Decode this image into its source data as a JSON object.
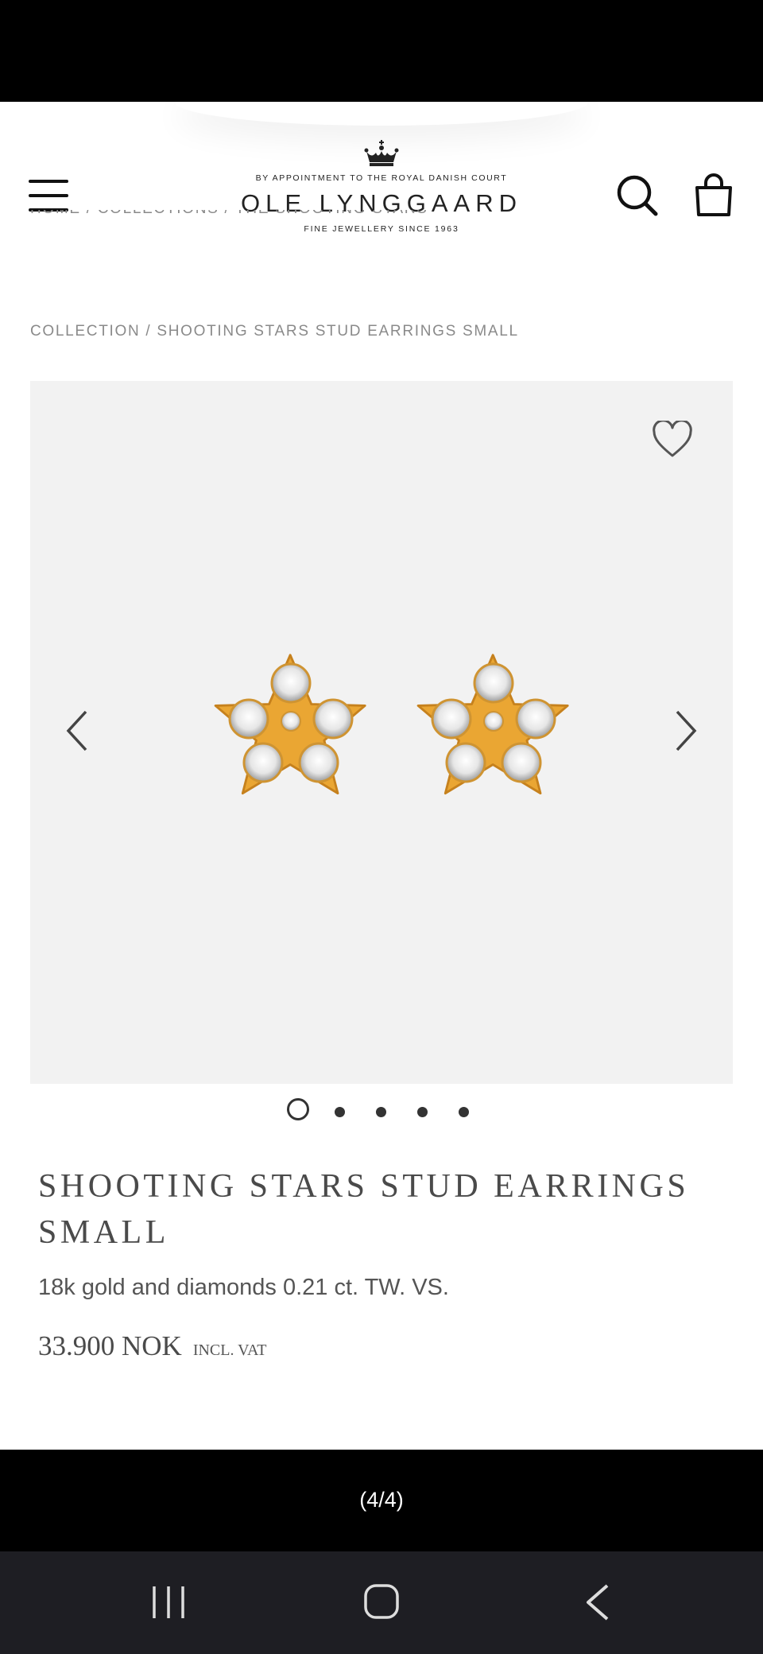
{
  "header": {
    "logo_top": "BY APPOINTMENT TO THE ROYAL DANISH COURT",
    "logo_name": "OLE LYNGGAARD",
    "logo_bottom": "FINE JEWELLERY SINCE 1963"
  },
  "breadcrumb": {
    "items": [
      "HOME",
      "COLLECTIONS",
      "THE SHOOTING STARS COLLECTION",
      "SHOOTING STARS STUD EARRINGS SMALL"
    ],
    "line1": "HOME / COLLECTIONS / THE SHOOTING STARS",
    "line2_link": "COLLECTION",
    "separator": " / ",
    "line2_current": "SHOOTING STARS STUD EARRINGS SMALL"
  },
  "gallery": {
    "image_count": 5,
    "active_index": 0
  },
  "product": {
    "title": "SHOOTING STARS STUD EARRINGS SMALL",
    "description": "18k gold and diamonds 0.21 ct. TW. VS.",
    "price": "33.900 NOK",
    "vat_label": "INCL. VAT"
  },
  "viewer": {
    "counter": "(4/4)"
  },
  "colors": {
    "page_bg": "#ffffff",
    "gallery_bg": "#f2f2f2",
    "text": "#4a4a4a",
    "gold": "#e8a630",
    "navbar": "#1e1e23"
  }
}
